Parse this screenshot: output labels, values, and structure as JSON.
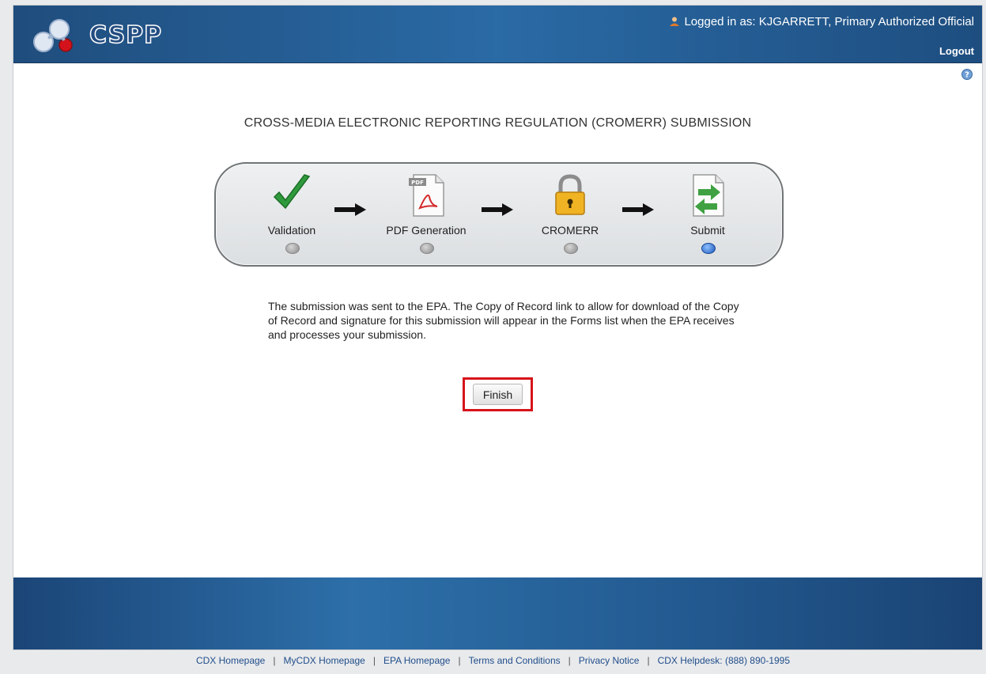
{
  "header": {
    "app_name": "CSPP",
    "logged_in_text": "Logged in as: KJGARRETT, Primary Authorized Official",
    "logout_label": "Logout"
  },
  "main": {
    "title": "CROSS-MEDIA ELECTRONIC REPORTING REGULATION (CROMERR) SUBMISSION",
    "steps": [
      {
        "label": "Validation",
        "icon": "checkmark-icon",
        "active": false
      },
      {
        "label": "PDF Generation",
        "icon": "pdf-icon",
        "active": false
      },
      {
        "label": "CROMERR",
        "icon": "lock-icon",
        "active": false
      },
      {
        "label": "Submit",
        "icon": "submit-document-icon",
        "active": true
      }
    ],
    "message": "The submission was sent to the EPA. The Copy of Record link to allow for download of the Copy of Record and signature for this submission will appear in the Forms list when the EPA receives and processes your submission.",
    "finish_label": "Finish"
  },
  "footer": {
    "links": [
      "CDX Homepage",
      "MyCDX Homepage",
      "EPA Homepage",
      "Terms and Conditions",
      "Privacy Notice",
      "CDX Helpdesk: (888) 890-1995"
    ]
  },
  "colors": {
    "header_blue": "#2a6aa5",
    "highlight_red": "#d6131a",
    "active_dot": "#1e57b9"
  }
}
